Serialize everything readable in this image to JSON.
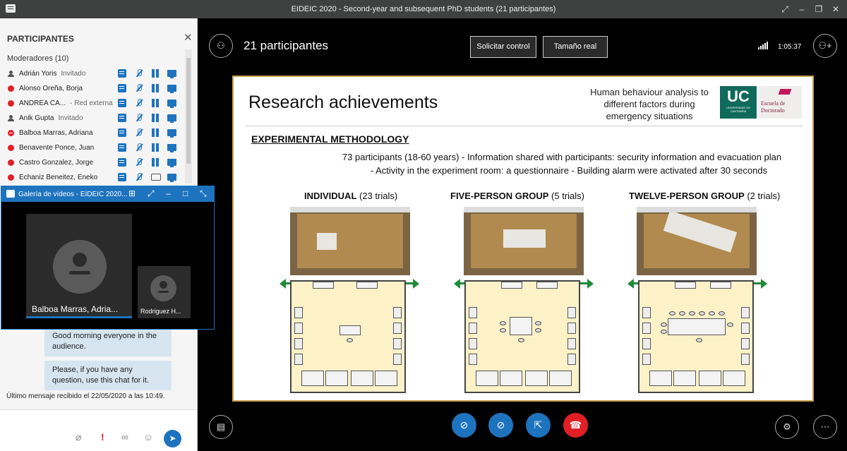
{
  "window": {
    "title": "EIDEIC 2020 - Second-year and subsequent PhD students (21 participantes)"
  },
  "sidebar": {
    "heading": "PARTICIPANTES",
    "moderators_label": "Moderadores (10)",
    "participants": [
      {
        "name": "Adrián Yoris",
        "tag": "Invitado",
        "status": "person"
      },
      {
        "name": "Alonso Oreña, Borja",
        "tag": "",
        "status": "red"
      },
      {
        "name": "ANDREA CA...",
        "tag": "- Red externa",
        "status": "red"
      },
      {
        "name": "Anik Gupta",
        "tag": "Invitado",
        "status": "person"
      },
      {
        "name": "Balboa Marras, Adriana",
        "tag": "",
        "status": "redstop"
      },
      {
        "name": "Benavente Ponce, Juan",
        "tag": "",
        "status": "red"
      },
      {
        "name": "Castro Gonzalez, Jorge",
        "tag": "",
        "status": "red"
      },
      {
        "name": "Echaniz Beneitez, Eneko",
        "tag": "",
        "status": "red"
      }
    ],
    "chat_messages": [
      "Good morning everyone in the audience.",
      "Please, if you have any question, use this chat for it."
    ],
    "last_message": "Último mensaje recibido el 22/05/2020 a las 10:49."
  },
  "gallery": {
    "title": "Galería de vídeos - EIDEIC 2020...",
    "main_tile": "Balboa Marras, Adria...",
    "small_tile": "Rodriguez H..."
  },
  "stage": {
    "participant_count": "21 participantes",
    "request_control": "Solicitar control",
    "actual_size": "Tamaño real",
    "timer": "1:05:37"
  },
  "slide": {
    "title": "Research achievements",
    "subtitle": "Human behaviour analysis to different factors during emergency situations",
    "uc_logo": "UC",
    "uc_logo_small": "UNIVERSIDAD DE CANTABRIA",
    "escuela_logo": "Escuela de Doctorado",
    "section": "EXPERIMENTAL METHODOLOGY",
    "line1": "73 participants (18-60 years)  -  Information shared with participants: security information and evacuation plan",
    "line2": "-  Activity in the experiment room: a questionnaire  -  Building alarm were activated after 30 seconds",
    "conditions": [
      {
        "name": "INDIVIDUAL",
        "detail": "(23 trials)"
      },
      {
        "name": "FIVE-PERSON GROUP",
        "detail": "(5 trials)"
      },
      {
        "name": "TWELVE-PERSON GROUP",
        "detail": "(2 trials)"
      }
    ]
  },
  "colors": {
    "accent": "#1e73be",
    "end_call": "#e21f26",
    "slide_border": "#c8a150",
    "arrow": "#1f8a3a"
  }
}
